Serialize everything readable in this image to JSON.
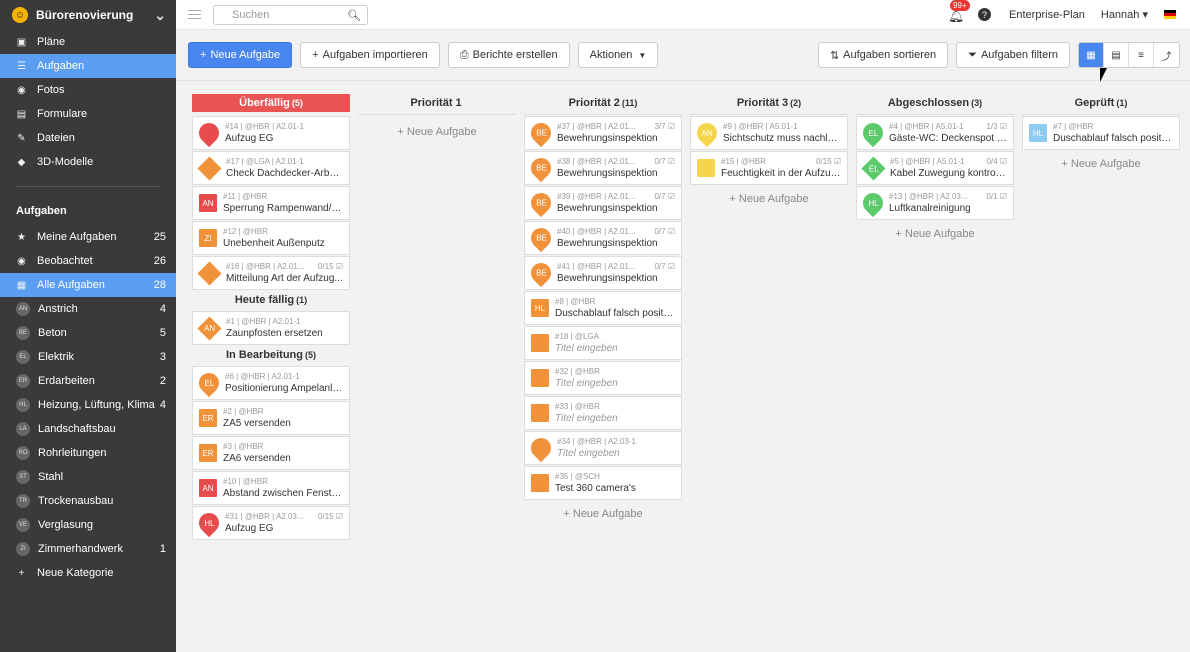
{
  "sidebar": {
    "project": "Bürorenovierung",
    "nav": [
      {
        "label": "Pläne",
        "icon": "plans-icon"
      },
      {
        "label": "Aufgaben",
        "icon": "list-icon",
        "active": true
      },
      {
        "label": "Fotos",
        "icon": "camera-icon"
      },
      {
        "label": "Formulare",
        "icon": "form-icon"
      },
      {
        "label": "Dateien",
        "icon": "paperclip-icon"
      },
      {
        "label": "3D-Modelle",
        "icon": "cube-icon"
      }
    ],
    "section_title": "Aufgaben",
    "filters": [
      {
        "label": "Meine Aufgaben",
        "count": "25",
        "icon": "star-icon"
      },
      {
        "label": "Beobachtet",
        "count": "26",
        "icon": "eye-icon"
      },
      {
        "label": "Alle Aufgaben",
        "count": "28",
        "icon": "grid-icon",
        "active": true
      }
    ],
    "categories": [
      {
        "abbr": "AN",
        "label": "Anstrich",
        "count": "4"
      },
      {
        "abbr": "BE",
        "label": "Beton",
        "count": "5"
      },
      {
        "abbr": "EL",
        "label": "Elektrik",
        "count": "3"
      },
      {
        "abbr": "ER",
        "label": "Erdarbeiten",
        "count": "2"
      },
      {
        "abbr": "HL",
        "label": "Heizung, Lüftung, Klima",
        "count": "4"
      },
      {
        "abbr": "LA",
        "label": "Landschaftsbau",
        "count": ""
      },
      {
        "abbr": "RO",
        "label": "Rohrleitungen",
        "count": ""
      },
      {
        "abbr": "ST",
        "label": "Stahl",
        "count": ""
      },
      {
        "abbr": "TR",
        "label": "Trockenausbau",
        "count": ""
      },
      {
        "abbr": "VE",
        "label": "Verglasung",
        "count": ""
      },
      {
        "abbr": "ZI",
        "label": "Zimmerhandwerk",
        "count": "1"
      }
    ],
    "new_category": "Neue Kategorie"
  },
  "topbar": {
    "search_placeholder": "Suchen",
    "notifications": "99+",
    "help": "?",
    "plan": "Enterprise-Plan",
    "user": "Hannah ▾"
  },
  "toolbar": {
    "new_task": "Neue Aufgabe",
    "import": "Aufgaben importieren",
    "reports": "Berichte erstellen",
    "actions": "Aktionen",
    "sort": "Aufgaben sortieren",
    "filter": "Aufgaben filtern"
  },
  "new_task_link": "+ Neue Aufgabe",
  "colors": {
    "orange": "#f0923a",
    "red": "#e84b4b",
    "yellow": "#f5d64a",
    "green": "#5cc96b",
    "lightblue": "#8fcaf0",
    "accent": "#4a86f0"
  },
  "columns": [
    {
      "title": "Überfällig",
      "count": "(5)",
      "overdue": true,
      "groups": [
        {
          "title": "",
          "count": "",
          "cards": [
            {
              "meta": "#14 | @HBR | A2.01-1",
              "prog": "",
              "title": "Aufzug EG",
              "shape": "pin",
              "color": "#e84b4b",
              "abbr": ""
            },
            {
              "meta": "#17 | @LGA | A2.01-1",
              "prog": "",
              "title": "Check Dachdecker-Arbeit...",
              "shape": "dia",
              "color": "#f0923a",
              "abbr": ""
            },
            {
              "meta": "#11 | @HBR",
              "prog": "",
              "title": "Sperrung Rampenwand/T...",
              "shape": "sq",
              "color": "#e84b4b",
              "abbr": "AN"
            },
            {
              "meta": "#12 | @HBR",
              "prog": "",
              "title": "Unebenheit Außenputz",
              "shape": "sq",
              "color": "#f0923a",
              "abbr": "ZI"
            },
            {
              "meta": "#16 | @HBR | A2.01...",
              "prog": "0/15 ☑",
              "title": "Mitteilung Art der Aufzug...",
              "shape": "dia",
              "color": "#f0923a",
              "abbr": ""
            }
          ]
        },
        {
          "title": "Heute fällig",
          "count": "(1)",
          "cards": [
            {
              "meta": "#1 | @HBR | A2.01-1",
              "prog": "",
              "title": "Zaunpfosten ersetzen",
              "shape": "dia",
              "color": "#f0923a",
              "abbr": "AN"
            }
          ]
        },
        {
          "title": "In Bearbeitung",
          "count": "(5)",
          "cards": [
            {
              "meta": "#6 | @HBR | A2.01-1",
              "prog": "",
              "title": "Positionierung Ampelanla...",
              "shape": "pin",
              "color": "#f0923a",
              "abbr": "EL"
            },
            {
              "meta": "#2 | @HBR",
              "prog": "",
              "title": "ZA5 versenden",
              "shape": "sq",
              "color": "#f0923a",
              "abbr": "ER"
            },
            {
              "meta": "#3 | @HBR",
              "prog": "",
              "title": "ZA6 versenden",
              "shape": "sq",
              "color": "#f0923a",
              "abbr": "ER"
            },
            {
              "meta": "#10 | @HBR",
              "prog": "",
              "title": "Abstand zwischen Fenste...",
              "shape": "sq",
              "color": "#e84b4b",
              "abbr": "AN"
            },
            {
              "meta": "#31 | @HBR | A2.03...",
              "prog": "0/15 ☑",
              "title": "Aufzug EG",
              "shape": "pin",
              "color": "#e84b4b",
              "abbr": "HL"
            }
          ]
        }
      ]
    },
    {
      "title": "Priorität 1",
      "count": "",
      "new": true,
      "groups": [
        {
          "title": "",
          "count": "",
          "cards": []
        }
      ]
    },
    {
      "title": "Priorität 2",
      "count": "(11)",
      "new": true,
      "groups": [
        {
          "title": "",
          "count": "",
          "cards": [
            {
              "meta": "#37 | @HBR | A2.01...",
              "prog": "3/7 ☑",
              "title": "Bewehrungsinspektion",
              "shape": "pin",
              "color": "#f0923a",
              "abbr": "BE"
            },
            {
              "meta": "#38 | @HBR | A2.01...",
              "prog": "0/7 ☑",
              "title": "Bewehrungsinspektion",
              "shape": "pin",
              "color": "#f0923a",
              "abbr": "BE"
            },
            {
              "meta": "#39 | @HBR | A2.01...",
              "prog": "0/7 ☑",
              "title": "Bewehrungsinspektion",
              "shape": "pin",
              "color": "#f0923a",
              "abbr": "BE"
            },
            {
              "meta": "#40 | @HBR | A2.01...",
              "prog": "0/7 ☑",
              "title": "Bewehrungsinspektion",
              "shape": "pin",
              "color": "#f0923a",
              "abbr": "BE"
            },
            {
              "meta": "#41 | @HBR | A2.01...",
              "prog": "0/7 ☑",
              "title": "Bewehrungsinspektion",
              "shape": "pin",
              "color": "#f0923a",
              "abbr": "BE"
            },
            {
              "meta": "#8 | @HBR",
              "prog": "",
              "title": "Duschablauf falsch positio...",
              "shape": "sq",
              "color": "#f0923a",
              "abbr": "HL"
            },
            {
              "meta": "#18 | @LGA",
              "prog": "",
              "title": "Titel eingeben",
              "ph": true,
              "shape": "sq",
              "color": "#f0923a",
              "abbr": ""
            },
            {
              "meta": "#32 | @HBR",
              "prog": "",
              "title": "Titel eingeben",
              "ph": true,
              "shape": "sq",
              "color": "#f0923a",
              "abbr": ""
            },
            {
              "meta": "#33 | @HBR",
              "prog": "",
              "title": "Titel eingeben",
              "ph": true,
              "shape": "sq",
              "color": "#f0923a",
              "abbr": ""
            },
            {
              "meta": "#34 | @HBR | A2.03-1",
              "prog": "",
              "title": "Titel eingeben",
              "ph": true,
              "shape": "pin",
              "color": "#f0923a",
              "abbr": ""
            },
            {
              "meta": "#35 | @SCH",
              "prog": "",
              "title": "Test 360 camera's",
              "shape": "sq",
              "color": "#f0923a",
              "abbr": ""
            }
          ]
        }
      ]
    },
    {
      "title": "Priorität 3",
      "count": "(2)",
      "new": true,
      "groups": [
        {
          "title": "",
          "count": "",
          "cards": [
            {
              "meta": "#9 | @HBR | A5.01-1",
              "prog": "",
              "title": "Sichtschutz muss nachlac...",
              "shape": "pin",
              "color": "#f5d64a",
              "abbr": "AN"
            },
            {
              "meta": "#15 | @HBR",
              "prog": "0/15 ☑",
              "title": "Feuchtigkeit in der Aufzug...",
              "shape": "sq",
              "color": "#f5d64a",
              "abbr": ""
            }
          ]
        }
      ]
    },
    {
      "title": "Abgeschlossen",
      "count": "(3)",
      "new": true,
      "groups": [
        {
          "title": "",
          "count": "",
          "cards": [
            {
              "meta": "#4 | @HBR | A5.01-1",
              "prog": "1/3 ☑",
              "title": "Gäste-WC: Deckenspot ü...",
              "shape": "pin",
              "color": "#5cc96b",
              "abbr": "EL"
            },
            {
              "meta": "#5 | @HBR | A5.01-1",
              "prog": "0/4 ☑",
              "title": "Kabel Zuwegung kontrolli...",
              "shape": "dia",
              "color": "#5cc96b",
              "abbr": "EL"
            },
            {
              "meta": "#13 | @HBR | A2.03...",
              "prog": "0/1 ☑",
              "title": "Luftkanalreinigung",
              "shape": "pin",
              "color": "#5cc96b",
              "abbr": "HL"
            }
          ]
        }
      ]
    },
    {
      "title": "Geprüft",
      "count": "(1)",
      "new": true,
      "groups": [
        {
          "title": "",
          "count": "",
          "cards": [
            {
              "meta": "#7 | @HBR",
              "prog": "",
              "title": "Duschablauf falsch positio...",
              "shape": "sq",
              "color": "#8fcaf0",
              "abbr": "HL"
            }
          ]
        }
      ]
    }
  ]
}
